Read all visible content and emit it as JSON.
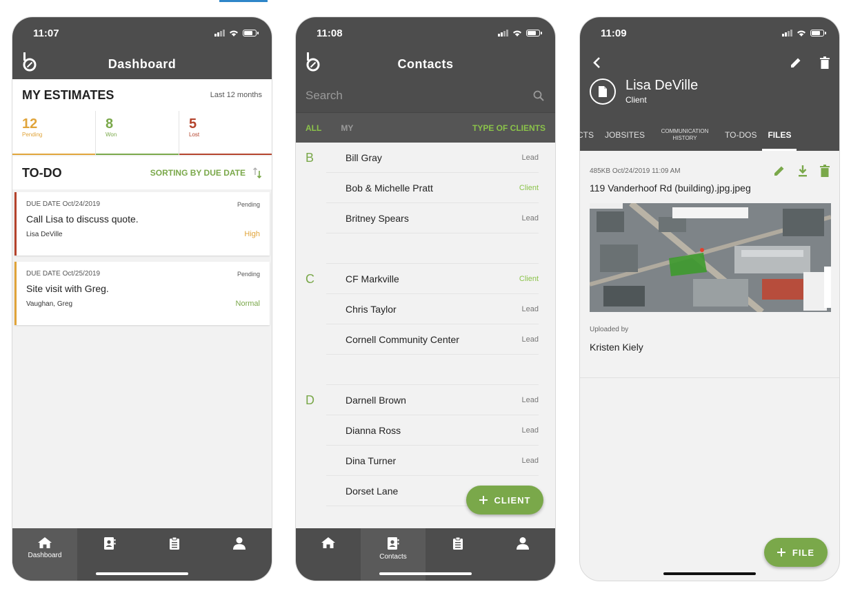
{
  "colors": {
    "accent": "#7aa84a",
    "pending": "#e0a43a",
    "won": "#7aa84a",
    "lost": "#b4432c",
    "bar": "#4d4d4d"
  },
  "phone1": {
    "time": "11:07",
    "title": "Dashboard",
    "estimates": {
      "title": "MY ESTIMATES",
      "range": "Last 12 months",
      "stats": [
        {
          "value": "12",
          "label": "Pending"
        },
        {
          "value": "8",
          "label": "Won"
        },
        {
          "value": "5",
          "label": "Lost"
        }
      ]
    },
    "todo": {
      "title": "TO-DO",
      "sort": "SORTING BY DUE DATE",
      "items": [
        {
          "due": "DUE DATE Oct/24/2019",
          "status": "Pending",
          "text": "Call Lisa to discuss quote.",
          "person": "Lisa DeVille",
          "priority": "High"
        },
        {
          "due": "DUE DATE Oct/25/2019",
          "status": "Pending",
          "text": "Site visit with Greg.",
          "person": "Vaughan, Greg",
          "priority": "Normal"
        }
      ]
    },
    "tabs": {
      "dashboard": "Dashboard"
    }
  },
  "phone2": {
    "time": "11:08",
    "title": "Contacts",
    "search_placeholder": "Search",
    "filters": {
      "all": "ALL",
      "my": "MY",
      "type": "TYPE OF CLIENTS"
    },
    "groups": [
      {
        "letter": "B",
        "contacts": [
          {
            "name": "Bill Gray",
            "type": "Lead"
          },
          {
            "name": "Bob & Michelle Pratt",
            "type": "Client"
          },
          {
            "name": "Britney Spears",
            "type": "Lead"
          }
        ]
      },
      {
        "letter": "C",
        "contacts": [
          {
            "name": "CF Markville",
            "type": "Client"
          },
          {
            "name": "Chris Taylor",
            "type": "Lead"
          },
          {
            "name": "Cornell Community Center",
            "type": "Lead"
          }
        ]
      },
      {
        "letter": "D",
        "contacts": [
          {
            "name": "Darnell Brown",
            "type": "Lead"
          },
          {
            "name": "Dianna Ross",
            "type": "Lead"
          },
          {
            "name": "Dina Turner",
            "type": "Lead"
          },
          {
            "name": "Dorset Lane",
            "type": ""
          }
        ]
      }
    ],
    "fab_label": "CLIENT",
    "tabs": {
      "contacts": "Contacts"
    }
  },
  "phone3": {
    "time": "11:09",
    "contact_name": "Lisa DeVille",
    "contact_role": "Client",
    "tabs": [
      "CTS",
      "JOBSITES",
      "COMMUNICATION HISTORY",
      "TO-DOS",
      "FILES"
    ],
    "file": {
      "size": "485KB",
      "date": "Oct/24/2019 11:09 AM",
      "name": "119 Vanderhoof Rd (building).jpg.jpeg",
      "uploaded_by_label": "Uploaded by",
      "uploaded_by": "Kristen Kiely"
    },
    "fab_label": "FILE"
  }
}
